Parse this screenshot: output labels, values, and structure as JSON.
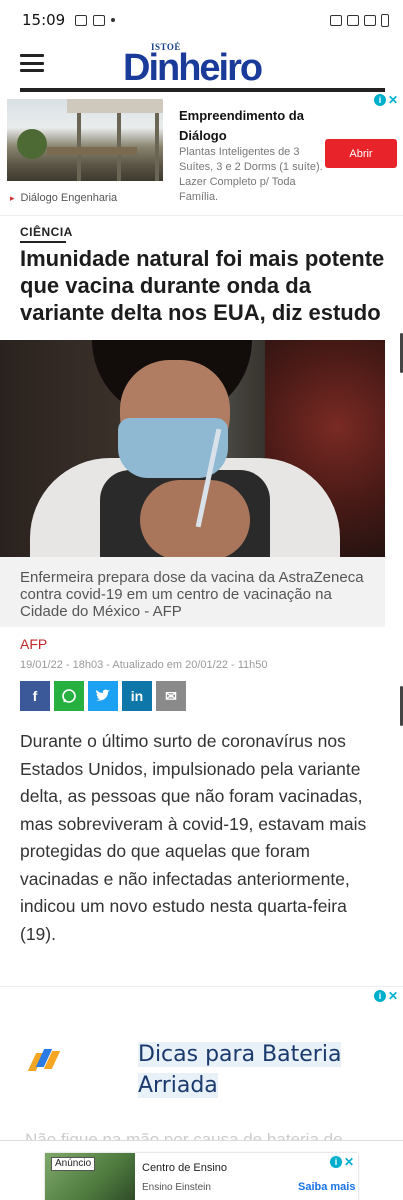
{
  "status_bar": {
    "time": "15:09"
  },
  "site": {
    "logo_small": "ISTOÉ",
    "logo_main": "Dinheiro"
  },
  "ad_top": {
    "title": "Empreendimento da Diálogo",
    "description": "Plantas Inteligentes de 3 Suítes, 3 e 2 Dorms (1 suíte). Lazer Completo p/ Toda Família.",
    "button": "Abrir",
    "advertiser": "Diálogo Engenharia"
  },
  "article": {
    "category": "CIÊNCIA",
    "headline": "Imunidade natural foi mais potente que vacina durante onda da variante delta nos EUA, diz estudo",
    "caption": "Enfermeira prepara dose da vacina da AstraZeneca contra covid-19 em um centro de vacinação na Cidade do México - AFP",
    "source": "AFP",
    "dateline": "19/01/22 - 18h03 - Atualizado em 20/01/22 - 11h50",
    "body": "Durante o último surto de coronavírus nos Estados Unidos, impulsionado pela variante delta, as pessoas que não foram vacinadas, mas sobreviveram à covid-19, estavam mais protegidas do que aquelas que foram vacinadas e não infectadas anteriormente, indicou um novo estudo nesta quarta-feira (19)."
  },
  "share": {
    "facebook": "f",
    "twitter": "t",
    "linkedin": "in",
    "email": "✉"
  },
  "ad_bottom": {
    "headline": "Dicas para Bateria Arriada",
    "faded_text": "Não fique na mão por causa de bateria de"
  },
  "sticky_ad": {
    "badge": "Anúncio",
    "title": "Centro de Ensino",
    "subtitle": "Ensino Einstein",
    "cta": "Saiba mais"
  },
  "colors": {
    "brand_blue": "#1b3b9a",
    "ad_red": "#e8232a",
    "source_red": "#c0262c"
  }
}
